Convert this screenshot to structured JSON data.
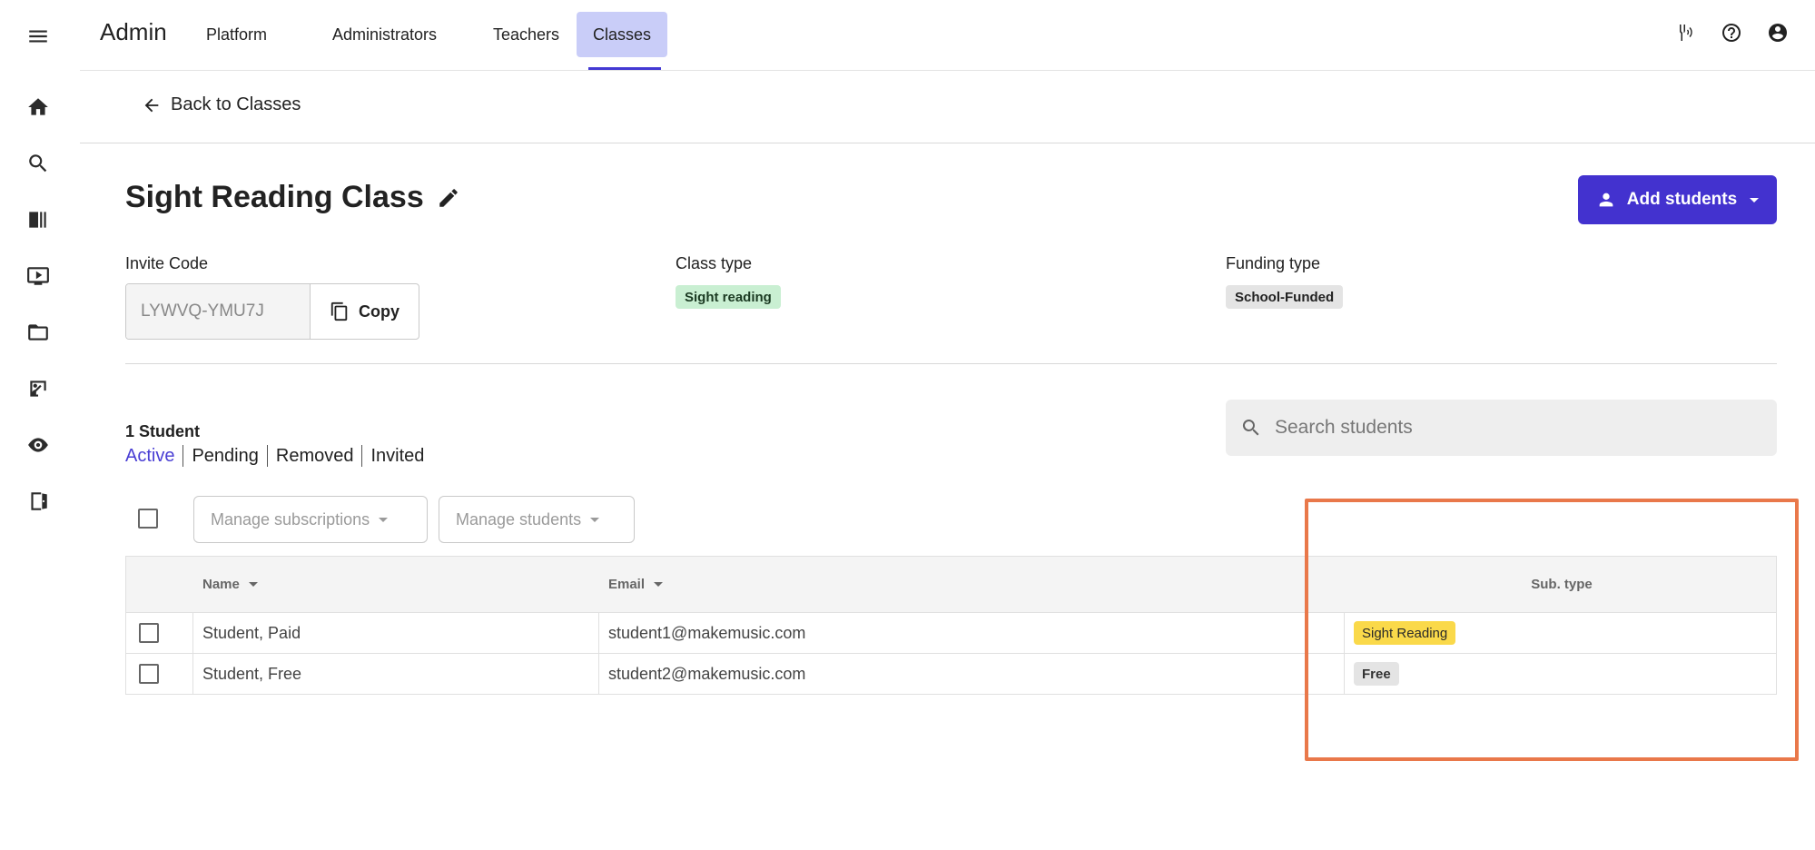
{
  "sidebar": {
    "icons": [
      "menu-icon",
      "home-icon",
      "search-icon",
      "library-icon",
      "video-icon",
      "folder-icon",
      "teacher-icon",
      "eye-icon",
      "exit-icon"
    ]
  },
  "topbar": {
    "brand": "Admin",
    "nav": [
      {
        "label": "Platform",
        "active": false
      },
      {
        "label": "Administrators",
        "active": false
      },
      {
        "label": "Teachers",
        "active": false
      },
      {
        "label": "Classes",
        "active": true
      }
    ],
    "icons": [
      "tuner-icon",
      "help-icon",
      "account-icon"
    ]
  },
  "back": {
    "label": "Back to Classes"
  },
  "class": {
    "title": "Sight Reading Class",
    "add_students_label": "Add students",
    "invite_label": "Invite Code",
    "invite_code": "LYWVQ-YMU7J",
    "copy_label": "Copy",
    "class_type_label": "Class type",
    "class_type": "Sight reading",
    "funding_type_label": "Funding type",
    "funding_type": "School-Funded"
  },
  "students": {
    "count_label": "1 Student",
    "filters": [
      "Active",
      "Pending",
      "Removed",
      "Invited"
    ],
    "active_filter": "Active",
    "search_placeholder": "Search students",
    "manage_subscriptions_label": "Manage subscriptions",
    "manage_students_label": "Manage students",
    "columns": {
      "name": "Name",
      "email": "Email",
      "sub_type": "Sub. type"
    },
    "rows": [
      {
        "name": "Student, Paid",
        "email": "student1@makemusic.com",
        "sub_type": "Sight Reading"
      },
      {
        "name": "Student, Free",
        "email": "student2@makemusic.com",
        "sub_type": "Free"
      }
    ]
  },
  "colors": {
    "accent": "#4332cf",
    "nav_active_bg": "#c9cdf8",
    "highlight": "#e9784a",
    "chip_green": "#c9efd2",
    "badge_yellow": "#fad94a"
  }
}
